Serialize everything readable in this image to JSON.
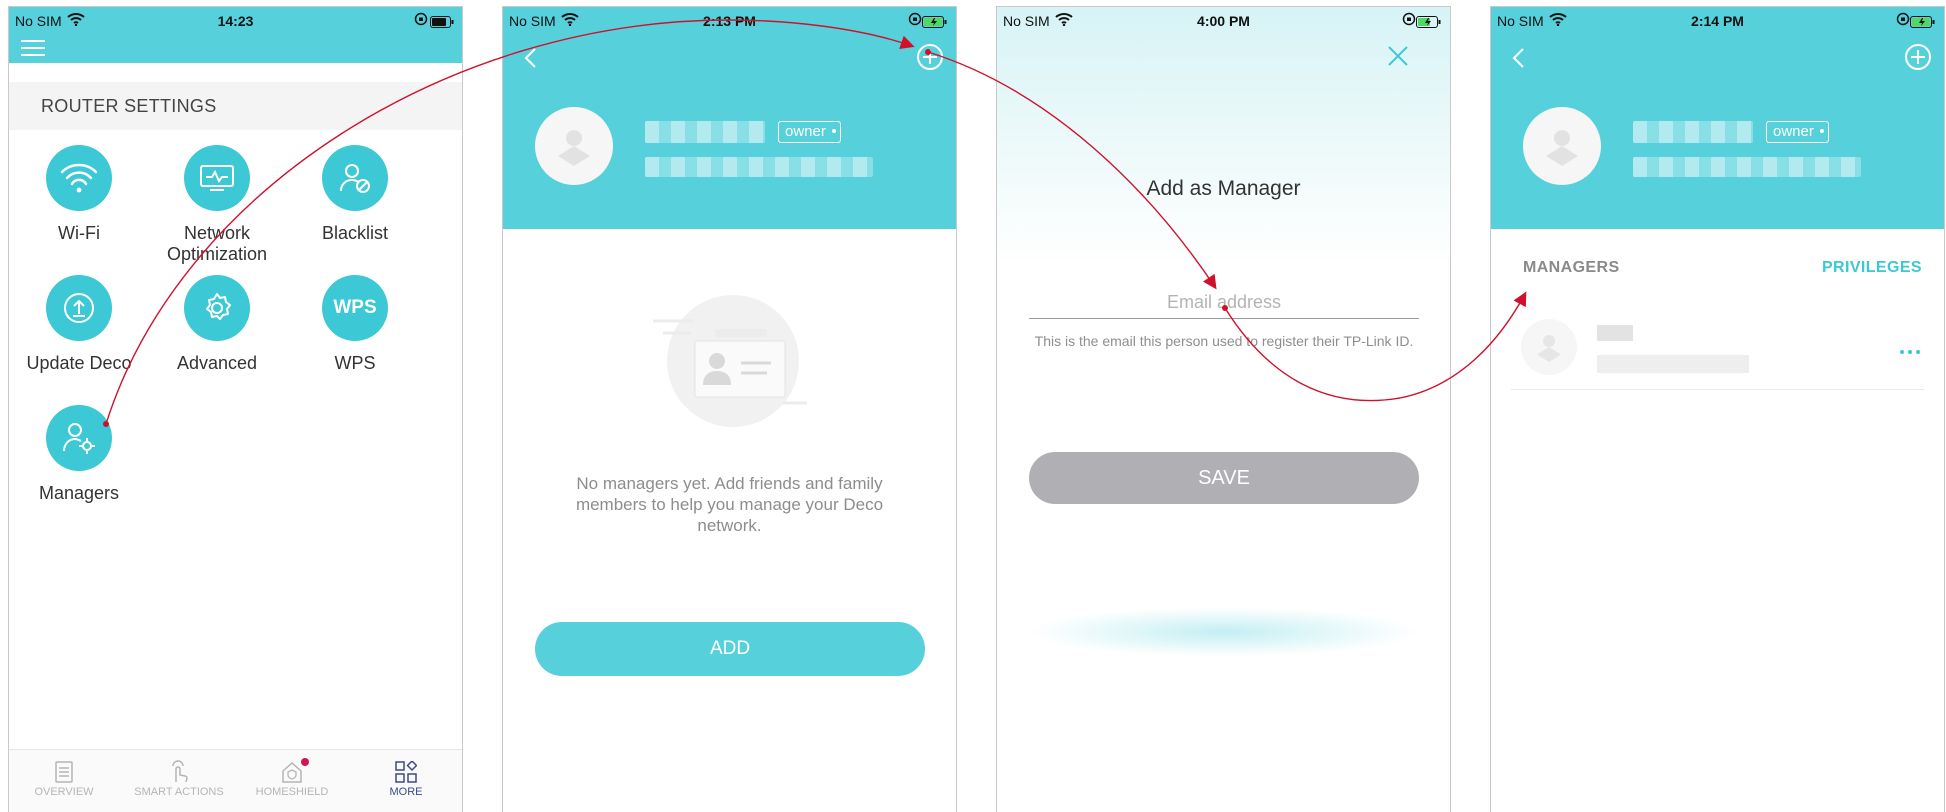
{
  "colors": {
    "teal": "#56d1dc",
    "teal_dark": "#3cc8d4",
    "arrow": "#d0112b",
    "tab_active": "#3b4b8c"
  },
  "screen1": {
    "status": {
      "carrier": "No SIM",
      "time": "14:23"
    },
    "section_title": "ROUTER SETTINGS",
    "tiles": [
      {
        "label": "Wi-Fi",
        "icon": "wifi-icon"
      },
      {
        "label": "Network\nOptimization",
        "icon": "network-optimization-icon"
      },
      {
        "label": "Blacklist",
        "icon": "blacklist-icon"
      },
      {
        "label": "Update Deco",
        "icon": "update-icon"
      },
      {
        "label": "Advanced",
        "icon": "gear-icon"
      },
      {
        "label": "WPS",
        "icon": "wps-icon",
        "text": "WPS"
      },
      {
        "label": "Managers",
        "icon": "managers-icon"
      }
    ],
    "tabs": [
      {
        "label": "OVERVIEW",
        "icon": "overview-icon"
      },
      {
        "label": "SMART ACTIONS",
        "icon": "smart-actions-icon"
      },
      {
        "label": "HOMESHIELD",
        "icon": "homeshield-icon"
      },
      {
        "label": "MORE",
        "icon": "more-icon",
        "active": true
      }
    ]
  },
  "screen2": {
    "status": {
      "carrier": "No SIM",
      "time": "2:13 PM"
    },
    "owner_tag": "owner",
    "empty_message": "No managers yet. Add friends and family members to help you manage your Deco network.",
    "add_button": "ADD"
  },
  "screen3": {
    "status": {
      "carrier": "No SIM",
      "time": "4:00 PM"
    },
    "title": "Add as Manager",
    "email_placeholder": "Email address",
    "hint": "This is the email this person used to register their TP-Link ID.",
    "save_button": "SAVE"
  },
  "screen4": {
    "status": {
      "carrier": "No SIM",
      "time": "2:14 PM"
    },
    "owner_tag": "owner",
    "managers_label": "MANAGERS",
    "privileges_label": "PRIVILEGES"
  }
}
